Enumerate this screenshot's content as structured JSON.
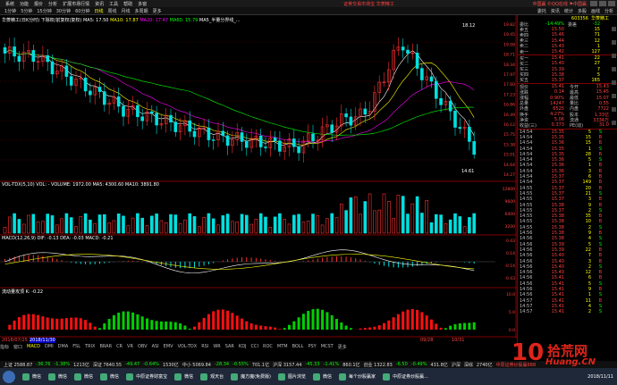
{
  "menu": {
    "items": [
      "系统",
      "功能",
      "报价",
      "分析",
      "扩展市场行情",
      "资讯",
      "工具",
      "帮助",
      "多窗"
    ],
    "title": "证券交易市场宝 华菱精工",
    "right": "中国赢   ©QQ在线  ⚑中国赢"
  },
  "toolbar": {
    "periods": [
      "1分钟",
      "5分钟",
      "15分钟",
      "30分钟",
      "60分钟",
      "日线",
      "周线",
      "月线",
      "多周期",
      "更多"
    ],
    "right": [
      "委托",
      "资讯",
      "统计",
      "多股",
      "画线",
      "分析"
    ]
  },
  "main_chart": {
    "legend_title": "华菱精工(日K分时) 下除权/前复权(复权)",
    "ma": [
      "MA5: 17.50",
      "MA10: 17.87",
      "MA20: 17.47",
      "MA60: 15.79"
    ],
    "right_label": "MA5_半量分界线_...",
    "high_label": "18.12",
    "low_label": "14.61",
    "axis": [
      "19.82",
      "19.45",
      "19.08",
      "18.71",
      "18.34",
      "17.97",
      "17.60",
      "17.23",
      "16.86",
      "16.49",
      "16.12",
      "15.75",
      "15.38",
      "15.01",
      "14.64",
      "14.27"
    ]
  },
  "vol": {
    "legend": "VOL-TDX(5,10) VOL: -  VOLUME: 1972.00  MA5: 4300.60  MA10: 3891.80",
    "axis": [
      "12800",
      "9600",
      "6400",
      "3200"
    ]
  },
  "macd": {
    "legend": "MACD(12,26,9) DIF: -0.13  DEA: -0.03  MACD: -0.21",
    "axis": [
      "0.43",
      "0.14",
      "-0.14",
      "-0.43"
    ]
  },
  "liq": {
    "legend": "流动量攻顶 K: -0.22",
    "axis": [
      "10.0",
      "5.0",
      "0.0"
    ]
  },
  "scale_row": {
    "left": "2018/07/25",
    "center": "2018/11/30",
    "dates": [
      "09/28",
      "10/31"
    ]
  },
  "tabs": [
    "指标",
    "窗口",
    "MACD",
    "DMI",
    "DMA",
    "FSL",
    "TRIX",
    "BRAR",
    "CR",
    "VR",
    "OBV",
    "ASI",
    "EMV",
    "VOL-TDX",
    "RSI",
    "WR",
    "SAR",
    "KDJ",
    "CCI",
    "ROC",
    "MTM",
    "BOLL",
    "PSY",
    "MCST",
    "更多"
  ],
  "quote": {
    "code": "603356",
    "name": "华菱精工",
    "ratio": {
      "label": "委比",
      "val": "-14.49%",
      "diff": "委差",
      "diffv": "-32"
    },
    "asks": [
      {
        "l": "卖五",
        "p": "15.50",
        "v": "15"
      },
      {
        "l": "卖四",
        "p": "15.46",
        "v": "71"
      },
      {
        "l": "卖三",
        "p": "15.44",
        "v": "12"
      },
      {
        "l": "卖二",
        "p": "15.43",
        "v": "1"
      },
      {
        "l": "卖一",
        "p": "15.42",
        "v": "127"
      }
    ],
    "bids": [
      {
        "l": "买一",
        "p": "15.41",
        "v": "22"
      },
      {
        "l": "买二",
        "p": "15.40",
        "v": "27"
      },
      {
        "l": "买三",
        "p": "15.39",
        "v": "7"
      },
      {
        "l": "买四",
        "p": "15.38",
        "v": "5"
      },
      {
        "l": "买五",
        "p": "15.37",
        "v": "165"
      }
    ],
    "stats": [
      {
        "l": "现价",
        "a": "15.41",
        "m": "今开",
        "b": "15.43"
      },
      {
        "l": "涨跌",
        "a": "0.14",
        "m": "最高",
        "b": "15.45"
      },
      {
        "l": "涨幅",
        "a": "0.90%",
        "m": "最低",
        "b": "15.07"
      },
      {
        "l": "总量",
        "a": "14247",
        "m": "量比",
        "b": "0.55"
      },
      {
        "l": "外盘",
        "a": "6525",
        "m": "内盘",
        "b": "7722"
      },
      {
        "l": "换手",
        "a": "4.27%",
        "m": "股本",
        "b": "1.33亿"
      },
      {
        "l": "净资",
        "a": "5.06",
        "m": "流通",
        "b": "3334万"
      },
      {
        "l": "收益(三)",
        "a": "0.373",
        "m": "PE(动)",
        "b": "31.0"
      }
    ],
    "ticks": [
      {
        "t": "14:54",
        "p": "15.35",
        "v": "5",
        "d": "S"
      },
      {
        "t": "14:54",
        "p": "15.35",
        "v": "15",
        "d": "B"
      },
      {
        "t": "14:54",
        "p": "15.36",
        "v": "15",
        "d": "B"
      },
      {
        "t": "14:54",
        "p": "15.35",
        "v": "1",
        "d": "S"
      },
      {
        "t": "14:54",
        "p": "15.35",
        "v": "28",
        "d": "B"
      },
      {
        "t": "14:54",
        "p": "15.36",
        "v": "5",
        "d": "S"
      },
      {
        "t": "14:54",
        "p": "15.36",
        "v": "1",
        "d": "B"
      },
      {
        "t": "14:54",
        "p": "15.36",
        "v": "3",
        "d": "B"
      },
      {
        "t": "14:54",
        "p": "15.37",
        "v": "6",
        "d": "B"
      },
      {
        "t": "14:54",
        "p": "15.37",
        "v": "149",
        "d": "B"
      },
      {
        "t": "14:55",
        "p": "15.37",
        "v": "20",
        "d": "B"
      },
      {
        "t": "14:55",
        "p": "15.37",
        "v": "21",
        "d": "S"
      },
      {
        "t": "14:55",
        "p": "15.37",
        "v": "3",
        "d": "B"
      },
      {
        "t": "14:55",
        "p": "15.38",
        "v": "9",
        "d": "B"
      },
      {
        "t": "14:55",
        "p": "15.37",
        "v": "2",
        "d": "S"
      },
      {
        "t": "14:55",
        "p": "15.38",
        "v": "35",
        "d": "B"
      },
      {
        "t": "14:55",
        "p": "15.38",
        "v": "10",
        "d": "B"
      },
      {
        "t": "14:55",
        "p": "15.38",
        "v": "2",
        "d": "S"
      },
      {
        "t": "14:56",
        "p": "15.38",
        "v": "9",
        "d": "B"
      },
      {
        "t": "14:56",
        "p": "15.38",
        "v": "4",
        "d": "S"
      },
      {
        "t": "14:56",
        "p": "15.39",
        "v": "5",
        "d": "S"
      },
      {
        "t": "14:56",
        "p": "15.39",
        "v": "22",
        "d": "B"
      },
      {
        "t": "14:56",
        "p": "15.40",
        "v": "7",
        "d": "B"
      },
      {
        "t": "14:56",
        "p": "15.40",
        "v": "3",
        "d": "B"
      },
      {
        "t": "14:56",
        "p": "15.40",
        "v": "2",
        "d": "S"
      },
      {
        "t": "14:56",
        "p": "15.40",
        "v": "12",
        "d": "B"
      },
      {
        "t": "14:56",
        "p": "15.41",
        "v": "6",
        "d": "B"
      },
      {
        "t": "14:56",
        "p": "15.41",
        "v": "5",
        "d": "S"
      },
      {
        "t": "14:56",
        "p": "15.41",
        "v": "9",
        "d": "B"
      },
      {
        "t": "14:56",
        "p": "15.41",
        "v": "1",
        "d": "S"
      },
      {
        "t": "14:57",
        "p": "15.41",
        "v": "11",
        "d": "B"
      },
      {
        "t": "14:57",
        "p": "15.41",
        "v": "4",
        "d": "S"
      },
      {
        "t": "14:57",
        "p": "15.41",
        "v": "2",
        "d": "S"
      }
    ]
  },
  "indexbar": [
    {
      "t": "上证 2588.87",
      "c": "wh"
    },
    {
      "t": "-36.76",
      "c": "dn"
    },
    {
      "t": "-1.38%",
      "c": "dn"
    },
    {
      "t": "1213亿",
      "c": "wh"
    },
    {
      "t": "深证 7640.55",
      "c": "wh"
    },
    {
      "t": "-49.47",
      "c": "dn"
    },
    {
      "t": "-0.64%",
      "c": "dn"
    },
    {
      "t": "1530亿",
      "c": "wh"
    },
    {
      "t": "中小 5069.84",
      "c": "wh"
    },
    {
      "t": "-28.34",
      "c": "dn"
    },
    {
      "t": "-0.55%",
      "c": "dn"
    },
    {
      "t": "701.1亿",
      "c": "wh"
    },
    {
      "t": "沪深 3157.44",
      "c": "wh"
    },
    {
      "t": "-45.33",
      "c": "dn"
    },
    {
      "t": "-1.41%",
      "c": "dn"
    },
    {
      "t": "860.1亿",
      "c": "wh"
    },
    {
      "t": "创业 1322.83",
      "c": "wh"
    },
    {
      "t": "-6.50",
      "c": "dn"
    },
    {
      "t": "-0.49%",
      "c": "dn"
    },
    {
      "t": "431.8亿",
      "c": "wh"
    },
    {
      "t": "沪深",
      "c": "wh"
    },
    {
      "t": "深综",
      "c": "wh"
    },
    {
      "t": "2740亿",
      "c": "wh"
    },
    {
      "t": "中原证券炒股赢688",
      "c": "up"
    }
  ],
  "taskbar": {
    "tasks": [
      "微信",
      "微信",
      "微信",
      "微信",
      "中原证券财富宝",
      "微信",
      "观天台",
      "魔方魔(免费版)",
      "图片浏览",
      "微信",
      "每个炒股赢家",
      "中原证券炒股赢..."
    ],
    "clock": "2018/11/11"
  },
  "watermark": {
    "num": "10",
    "cn": "拾荒网",
    "url": "Huang.CN"
  }
}
